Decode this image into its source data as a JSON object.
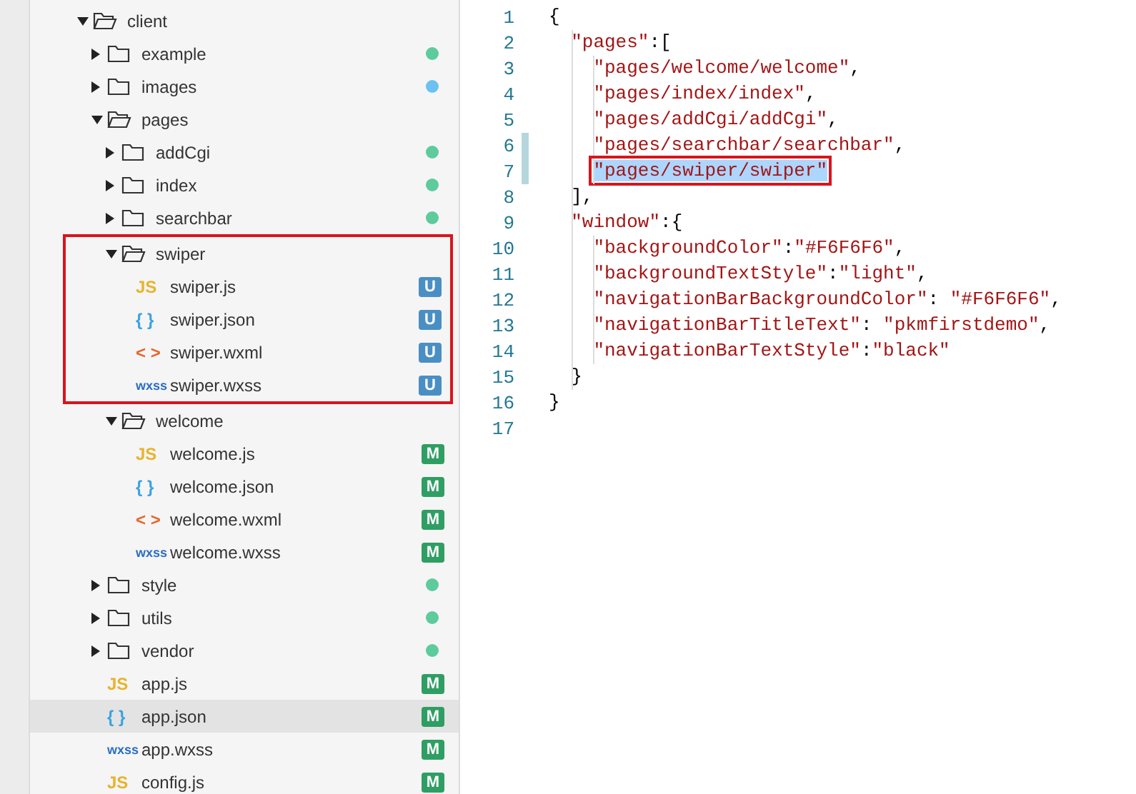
{
  "explorer": {
    "tree": [
      {
        "kind": "folder",
        "name": "client",
        "expanded": true,
        "selected": false,
        "highlighted": false,
        "children": [
          {
            "kind": "folder",
            "name": "example",
            "expanded": false,
            "selected": false,
            "highlighted": false,
            "status": {
              "kind": "dot",
              "color": "#5ecb9c"
            }
          },
          {
            "kind": "folder",
            "name": "images",
            "expanded": false,
            "selected": false,
            "highlighted": false,
            "status": {
              "kind": "dot",
              "color": "#6cc1f3"
            }
          },
          {
            "kind": "folder",
            "name": "pages",
            "expanded": true,
            "selected": false,
            "highlighted": false,
            "children": [
              {
                "kind": "folder",
                "name": "addCgi",
                "expanded": false,
                "selected": false,
                "highlighted": false,
                "status": {
                  "kind": "dot",
                  "color": "#5ecb9c"
                }
              },
              {
                "kind": "folder",
                "name": "index",
                "expanded": false,
                "selected": false,
                "highlighted": false,
                "status": {
                  "kind": "dot",
                  "color": "#5ecb9c"
                }
              },
              {
                "kind": "folder",
                "name": "searchbar",
                "expanded": false,
                "selected": false,
                "highlighted": false,
                "status": {
                  "kind": "dot",
                  "color": "#5ecb9c"
                }
              },
              {
                "kind": "folder",
                "name": "swiper",
                "expanded": true,
                "selected": false,
                "highlighted": true,
                "children": [
                  {
                    "kind": "script",
                    "icon": "JS",
                    "name": "swiper.js",
                    "selected": false,
                    "status": {
                      "kind": "badge",
                      "text": "U",
                      "color": "#4a8fc4"
                    }
                  },
                  {
                    "kind": "data",
                    "icon": "{ }",
                    "name": "swiper.json",
                    "selected": false,
                    "status": {
                      "kind": "badge",
                      "text": "U",
                      "color": "#4a8fc4"
                    }
                  },
                  {
                    "kind": "markup",
                    "icon": "< >",
                    "name": "swiper.wxml",
                    "selected": false,
                    "status": {
                      "kind": "badge",
                      "text": "U",
                      "color": "#4a8fc4"
                    }
                  },
                  {
                    "kind": "style",
                    "icon": "wxss",
                    "name": "swiper.wxss",
                    "selected": false,
                    "status": {
                      "kind": "badge",
                      "text": "U",
                      "color": "#4a8fc4"
                    }
                  }
                ]
              },
              {
                "kind": "folder",
                "name": "welcome",
                "expanded": true,
                "selected": false,
                "highlighted": false,
                "children": [
                  {
                    "kind": "script",
                    "icon": "JS",
                    "name": "welcome.js",
                    "selected": false,
                    "status": {
                      "kind": "badge",
                      "text": "M",
                      "color": "#2f9e63"
                    }
                  },
                  {
                    "kind": "data",
                    "icon": "{ }",
                    "name": "welcome.json",
                    "selected": false,
                    "status": {
                      "kind": "badge",
                      "text": "M",
                      "color": "#2f9e63"
                    }
                  },
                  {
                    "kind": "markup",
                    "icon": "< >",
                    "name": "welcome.wxml",
                    "selected": false,
                    "status": {
                      "kind": "badge",
                      "text": "M",
                      "color": "#2f9e63"
                    }
                  },
                  {
                    "kind": "style",
                    "icon": "wxss",
                    "name": "welcome.wxss",
                    "selected": false,
                    "status": {
                      "kind": "badge",
                      "text": "M",
                      "color": "#2f9e63"
                    }
                  }
                ]
              }
            ]
          },
          {
            "kind": "folder",
            "name": "style",
            "expanded": false,
            "selected": false,
            "highlighted": false,
            "status": {
              "kind": "dot",
              "color": "#5ecb9c"
            }
          },
          {
            "kind": "folder",
            "name": "utils",
            "expanded": false,
            "selected": false,
            "highlighted": false,
            "status": {
              "kind": "dot",
              "color": "#5ecb9c"
            }
          },
          {
            "kind": "folder",
            "name": "vendor",
            "expanded": false,
            "selected": false,
            "highlighted": false,
            "status": {
              "kind": "dot",
              "color": "#5ecb9c"
            }
          },
          {
            "kind": "script",
            "icon": "JS",
            "name": "app.js",
            "selected": false,
            "status": {
              "kind": "badge",
              "text": "M",
              "color": "#2f9e63"
            }
          },
          {
            "kind": "data",
            "icon": "{ }",
            "name": "app.json",
            "selected": true,
            "status": {
              "kind": "badge",
              "text": "M",
              "color": "#2f9e63"
            }
          },
          {
            "kind": "style",
            "icon": "wxss",
            "name": "app.wxss",
            "selected": false,
            "status": {
              "kind": "badge",
              "text": "M",
              "color": "#2f9e63"
            }
          },
          {
            "kind": "script",
            "icon": "JS",
            "name": "config.js",
            "selected": false,
            "status": {
              "kind": "badge",
              "text": "M",
              "color": "#2f9e63"
            }
          }
        ]
      }
    ]
  },
  "editor": {
    "lines": [
      {
        "number": "1",
        "text": "{",
        "modified": false,
        "selected": false
      },
      {
        "number": "2",
        "text": "  \"pages\":[",
        "modified": false,
        "selected": false
      },
      {
        "number": "3",
        "text": "    \"pages/welcome/welcome\",",
        "modified": false,
        "selected": false
      },
      {
        "number": "4",
        "text": "    \"pages/index/index\",",
        "modified": false,
        "selected": false
      },
      {
        "number": "5",
        "text": "    \"pages/addCgi/addCgi\",",
        "modified": false,
        "selected": false
      },
      {
        "number": "6",
        "text": "    \"pages/searchbar/searchbar\",",
        "modified": true,
        "selected": false
      },
      {
        "number": "7",
        "text": "    \"pages/swiper/swiper\"",
        "modified": true,
        "selected": true
      },
      {
        "number": "8",
        "text": "  ],",
        "modified": false,
        "selected": false
      },
      {
        "number": "9",
        "text": "  \"window\":{",
        "modified": false,
        "selected": false
      },
      {
        "number": "10",
        "text": "    \"backgroundColor\":\"#F6F6F6\",",
        "modified": false,
        "selected": false
      },
      {
        "number": "11",
        "text": "    \"backgroundTextStyle\":\"light\",",
        "modified": false,
        "selected": false
      },
      {
        "number": "12",
        "text": "    \"navigationBarBackgroundColor\": \"#F6F6F6\",",
        "modified": false,
        "selected": false
      },
      {
        "number": "13",
        "text": "    \"navigationBarTitleText\": \"pkmfirstdemo\",",
        "modified": false,
        "selected": false
      },
      {
        "number": "14",
        "text": "    \"navigationBarTextStyle\":\"black\"",
        "modified": false,
        "selected": false
      },
      {
        "number": "15",
        "text": "  }",
        "modified": false,
        "selected": false
      },
      {
        "number": "16",
        "text": "}",
        "modified": false,
        "selected": false
      },
      {
        "number": "17",
        "modified": false,
        "selected": false
      }
    ]
  }
}
